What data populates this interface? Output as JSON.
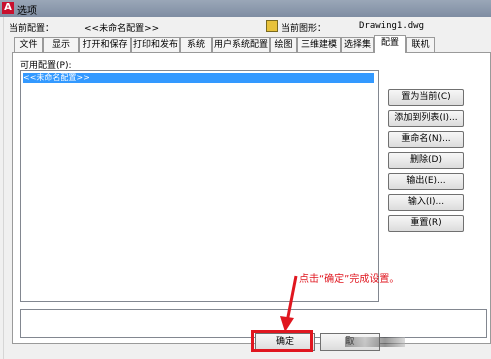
{
  "window": {
    "app_icon": "A",
    "title": "选项"
  },
  "header": {
    "current_profile_label": "当前配置：",
    "current_profile_value": "<<未命名配置>>",
    "current_drawing_label": "当前图形：",
    "current_drawing_value": "Drawing1.dwg"
  },
  "tabs": [
    {
      "label": "文件"
    },
    {
      "label": "显示"
    },
    {
      "label": "打开和保存"
    },
    {
      "label": "打印和发布"
    },
    {
      "label": "系统"
    },
    {
      "label": "用户系统配置"
    },
    {
      "label": "绘图"
    },
    {
      "label": "三维建模"
    },
    {
      "label": "选择集"
    },
    {
      "label": "配置"
    },
    {
      "label": "联机"
    }
  ],
  "active_tab": "配置",
  "profiles": {
    "label": "可用配置(P):",
    "items": [
      "<<未命名配置>>"
    ]
  },
  "side_buttons": [
    "置为当前(C)",
    "添加到列表(I)...",
    "重命名(N)...",
    "删除(D)",
    "输出(E)...",
    "输入(I)...",
    "重置(R)"
  ],
  "annotation": "点击“确定”完成设置。",
  "bottom_buttons": {
    "ok": "确定",
    "cancel": "取"
  },
  "colors": {
    "highlight_red": "#e0161f",
    "selection_blue": "#3399ff"
  }
}
